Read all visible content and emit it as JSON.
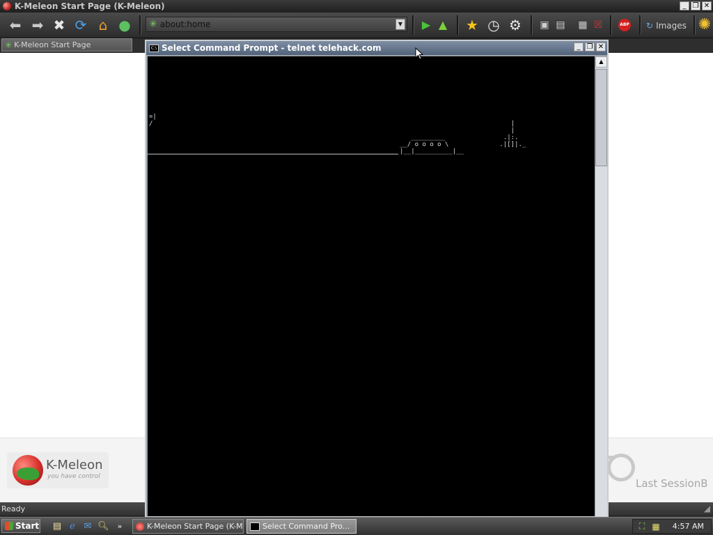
{
  "browser": {
    "window_title": "K-Meleon Start Page (K-Meleon)",
    "address": "about:home",
    "images_label": "Images",
    "tab_label": "K-Meleon Start Page",
    "status": "Ready"
  },
  "start_page": {
    "logo_name": "K-Meleon",
    "logo_tagline": "you have control",
    "last_session_label": "Last SessionB"
  },
  "console": {
    "title": "Select Command Prompt - telnet telehack.com",
    "ascii_left": "=|\n/",
    "ascii_train": "   _________\n__/ o o o o \\ \n|__|__________|__",
    "ascii_tower": "    |\n    |\n  .|:.\n .|[]|._"
  },
  "taskbar": {
    "start_label": "Start",
    "overflow_label": "»",
    "tasks": [
      {
        "label": "K-Meleon Start Page (K-M..."
      },
      {
        "label": "Select Command Pro..."
      }
    ],
    "clock": "4:57 AM"
  }
}
